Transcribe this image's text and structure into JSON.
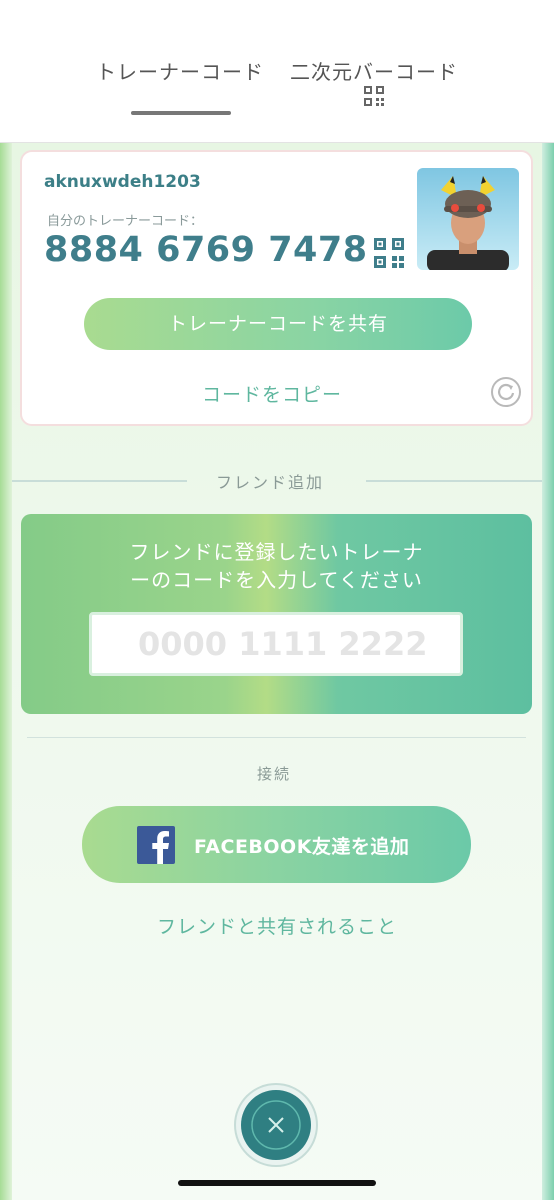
{
  "tabs": {
    "trainer_code": "トレーナーコード",
    "qr_code": "二次元バーコード"
  },
  "card": {
    "username": "aknuxwdeh1203",
    "code_label": "自分のトレーナーコード：",
    "code_value": "8884 6769 7478",
    "share_button": "トレーナーコードを共有",
    "copy_link": "コードをコピー"
  },
  "friend_add": {
    "section_label": "フレンド追加",
    "instructions": "フレンドに登録したいトレーナ\nーのコードを入力してください",
    "input_placeholder": "0000 1111 2222"
  },
  "connect": {
    "section_label": "接続",
    "facebook_button": "FACEBOOK友達を追加",
    "share_info_link": "フレンドと共有されること"
  },
  "colors": {
    "accent_teal": "#3f7e8b",
    "link_green": "#5fb79f",
    "close_button": "#2f7f82"
  }
}
